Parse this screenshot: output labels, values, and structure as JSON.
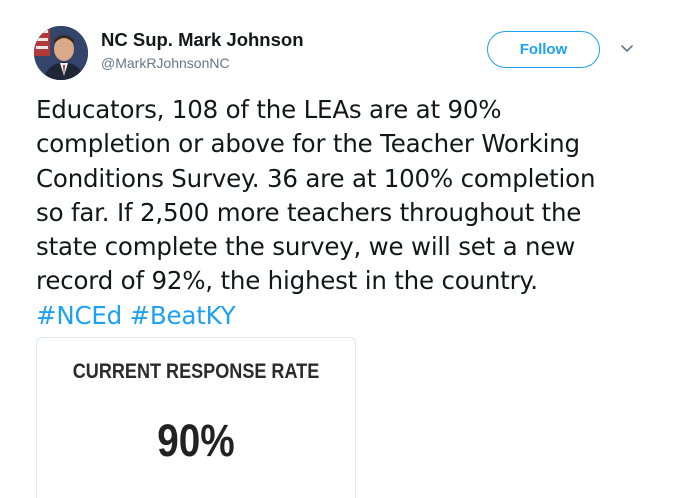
{
  "author": {
    "display_name": "NC Sup. Mark Johnson",
    "handle": "@MarkRJohnsonNC",
    "avatar_icon": "profile-photo-avatar"
  },
  "actions": {
    "follow_label": "Follow",
    "more_icon": "chevron-down-icon"
  },
  "tweet": {
    "lines": [
      "Educators, 108 of the LEAs are at 90%",
      "completion or above for the Teacher Working",
      "Conditions Survey. 36 are at 100% completion",
      "so far. If 2,500 more teachers throughout the",
      "state complete the survey, we will set a new",
      "record of 92%, the highest in the country."
    ],
    "hashtags": [
      "#NCEd",
      "#BeatKY"
    ]
  },
  "card": {
    "label": "CURRENT RESPONSE RATE",
    "value": "90%"
  },
  "colors": {
    "link_blue": "#1da1f2",
    "text": "#14171a",
    "muted": "#657786"
  }
}
